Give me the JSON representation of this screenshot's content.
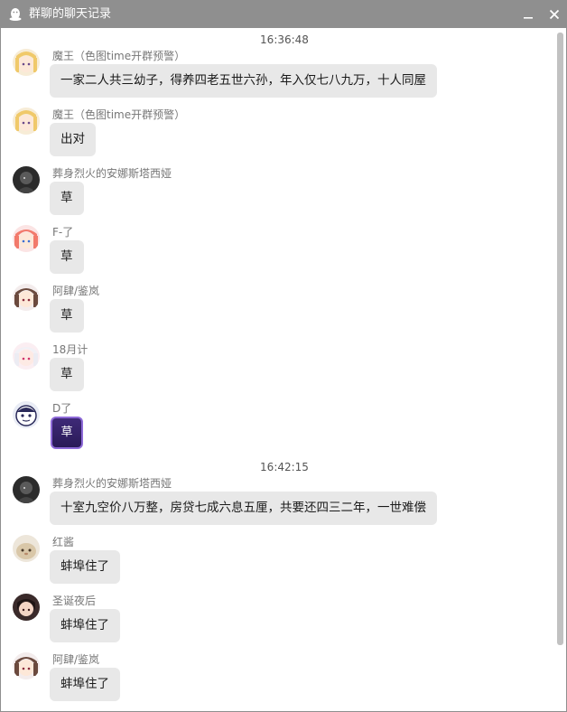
{
  "window": {
    "title": "群聊的聊天记录",
    "title_icon": "qq-penguin-icon",
    "minimize_icon": "minimize-icon",
    "close_icon": "close-icon"
  },
  "colors": {
    "titlebar_bg": "#8f8f8f",
    "bubble_bg": "#e8e8e8",
    "nickname": "#777777",
    "timestamp": "#555555",
    "scrollbar_thumb": "#c1c1c1"
  },
  "timestamps": [
    "16:36:48",
    "16:42:15"
  ],
  "messages": [
    {
      "nickname": "魔王（色图time开群预警）",
      "text": "一家二人共三幼子，得养四老五世六孙，年入仅七八九万，十人同屋",
      "avatar": "avatar-anime-blonde-girl"
    },
    {
      "nickname": "魔王（色图time开群预警）",
      "text": "出对",
      "avatar": "avatar-anime-blonde-girl"
    },
    {
      "nickname": "葬身烈火的安娜斯塔西娅",
      "text": "草",
      "avatar": "avatar-dark-figure"
    },
    {
      "nickname": "F-了",
      "text": "草",
      "avatar": "avatar-pink-hair-girl"
    },
    {
      "nickname": "阿肆/鉴岚",
      "text": "草",
      "avatar": "avatar-brown-hair-girl"
    },
    {
      "nickname": "18月计",
      "text": "草",
      "avatar": "avatar-white-hair-girl"
    },
    {
      "nickname": "D了",
      "text": "草",
      "avatar": "avatar-cartoon-character",
      "sticker": true
    },
    {
      "nickname": "葬身烈火的安娜斯塔西娅",
      "text": "十室九空价八万整，房贷七成六息五厘，共要还四三二年，一世难偿",
      "avatar": "avatar-dark-figure"
    },
    {
      "nickname": "红酱",
      "text": "蚌埠住了",
      "avatar": "avatar-beige-creature"
    },
    {
      "nickname": "圣诞夜后",
      "text": "蚌埠住了",
      "avatar": "avatar-dark-hair-girl"
    },
    {
      "nickname": "阿肆/鉴岚",
      "text": "蚌埠住了",
      "avatar": "avatar-brown-hair-girl"
    }
  ]
}
